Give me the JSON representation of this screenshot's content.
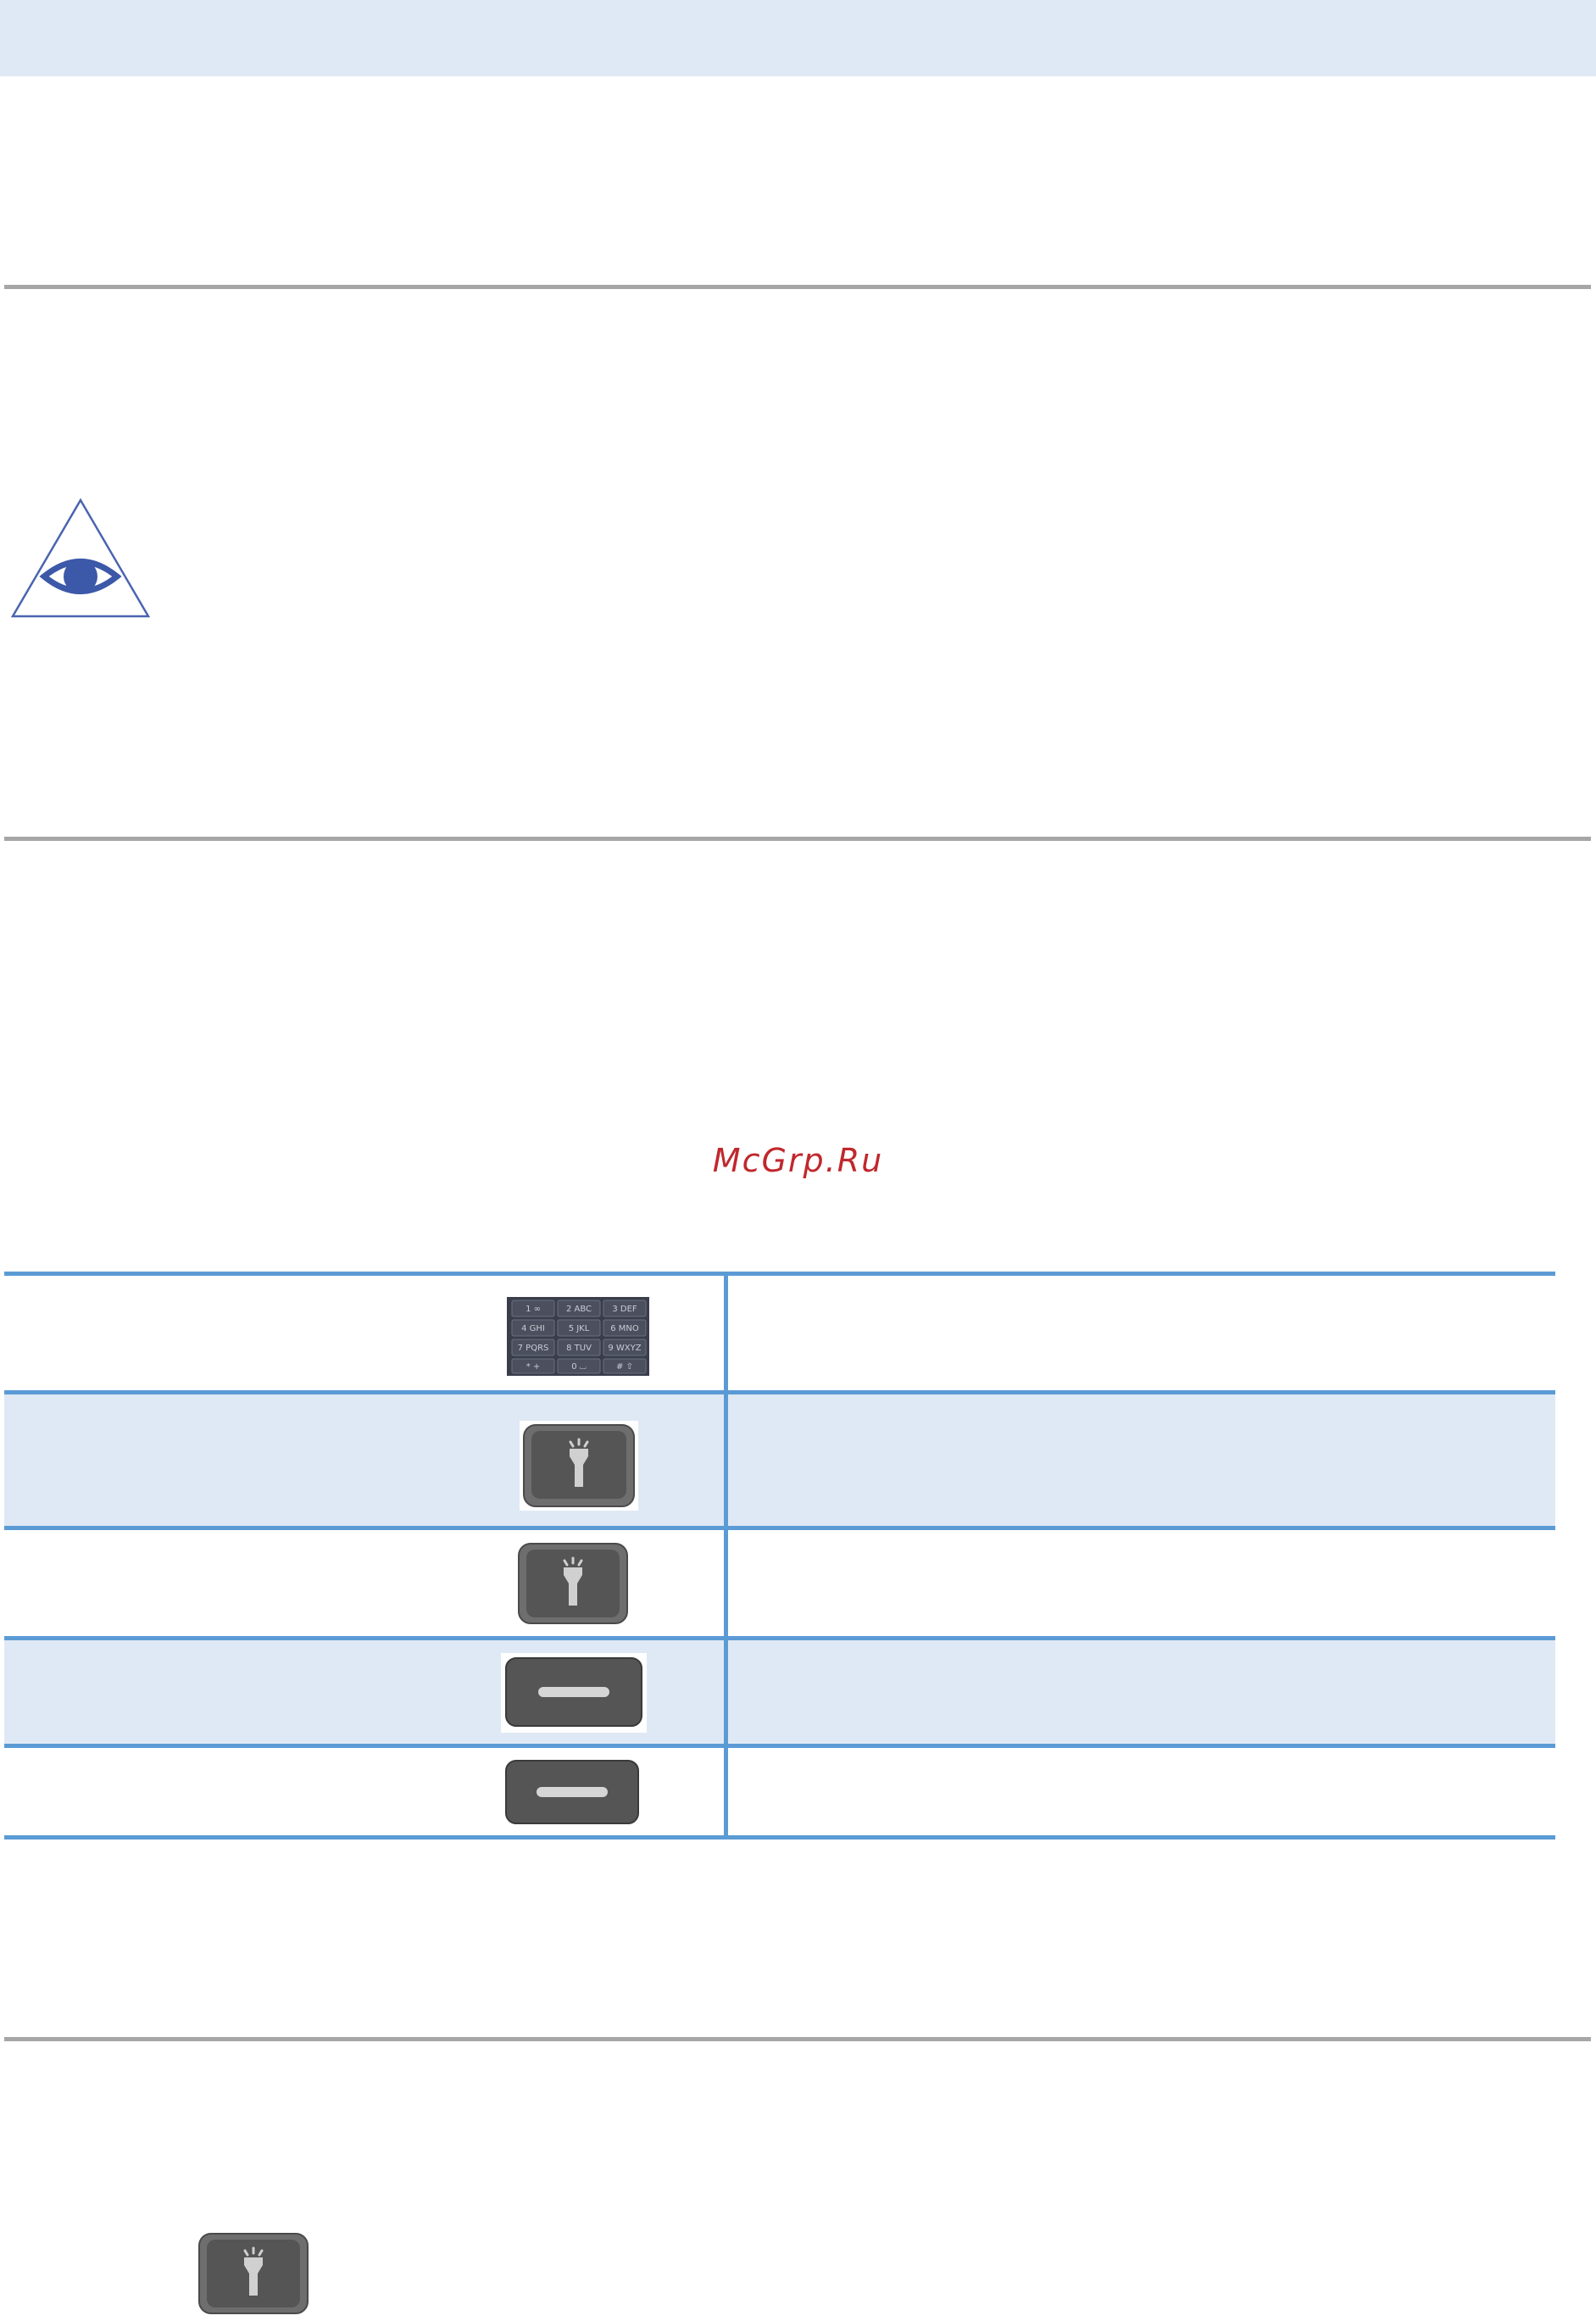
{
  "watermark": "McGrp.Ru",
  "colors": {
    "header_band": "#dfe9f5",
    "rule": "#a6a6a6",
    "table_border": "#5b9bd5",
    "shaded_row": "#dfe9f5",
    "watermark": "#c0282d",
    "eye_icon": "#3c58a8"
  },
  "icons": {
    "note": "eye-warning-icon",
    "keypad": "numeric-keypad-icon",
    "flashlight_key": "flashlight-key-icon",
    "soft_key": "soft-key-icon"
  },
  "keypad_labels": [
    "1 ∞",
    "2 ABC",
    "3 DEF",
    "4 GHI",
    "5 JKL",
    "6 MNO",
    "7 PQRS",
    "8 TUV",
    "9 WXYZ",
    "* +",
    "0 ⌴",
    "# ⇧"
  ],
  "table": {
    "rows": [
      {
        "icon": "numeric-keypad-icon",
        "shaded": false
      },
      {
        "icon": "flashlight-key-icon",
        "shaded": true
      },
      {
        "icon": "flashlight-key-icon",
        "shaded": false
      },
      {
        "icon": "soft-key-icon",
        "shaded": true
      },
      {
        "icon": "soft-key-icon",
        "shaded": false
      }
    ]
  }
}
